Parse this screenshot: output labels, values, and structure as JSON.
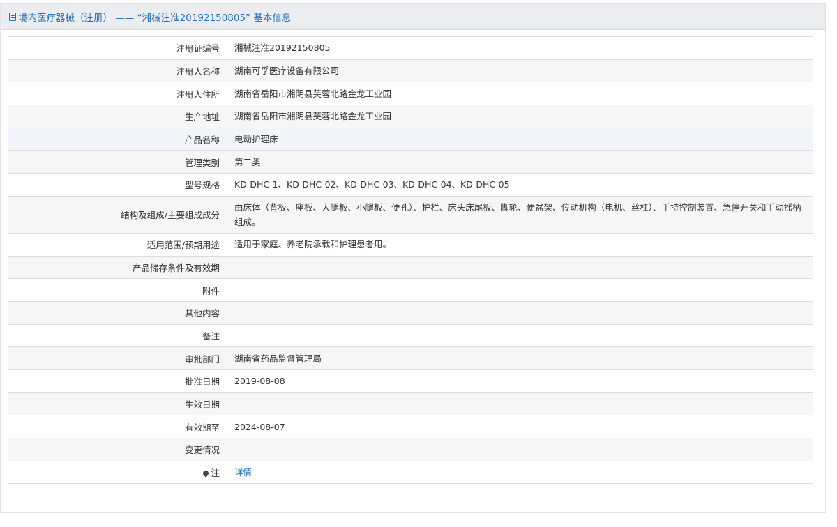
{
  "header": {
    "title": "境内医疗器械（注册） —— “湘械注准20192150805” 基本信息",
    "icon": "document-icon"
  },
  "rows": [
    {
      "label": "注册证编号",
      "value": "湘械注准20192150805"
    },
    {
      "label": "注册人名称",
      "value": "湖南可孚医疗设备有限公司"
    },
    {
      "label": "注册人住所",
      "value": "湖南省岳阳市湘阴县芙蓉北路金龙工业园"
    },
    {
      "label": "生产地址",
      "value": "湖南省岳阳市湘阴县芙蓉北路金龙工业园"
    },
    {
      "label": "产品名称",
      "value": "电动护理床"
    },
    {
      "label": "管理类别",
      "value": "第二类"
    },
    {
      "label": "型号规格",
      "value": "KD-DHC-1、KD-DHC-02、KD-DHC-03、KD-DHC-04、KD-DHC-05"
    },
    {
      "label": "结构及组成/主要组成成分",
      "value": "由床体（背板、座板、大腿板、小腿板、便孔）、护栏、床头床尾板、脚轮、便盆架、传动机构（电机、丝杠）、手持控制装置、急停开关和手动摇柄组成。"
    },
    {
      "label": "适用范围/预期用途",
      "value": "适用于家庭、养老院承载和护理患者用。"
    },
    {
      "label": "产品储存条件及有效期",
      "value": ""
    },
    {
      "label": "附件",
      "value": ""
    },
    {
      "label": "其他内容",
      "value": ""
    },
    {
      "label": "备注",
      "value": ""
    },
    {
      "label": "审批部门",
      "value": "湖南省药品监督管理局"
    },
    {
      "label": "批准日期",
      "value": "2019-08-08"
    },
    {
      "label": "生效日期",
      "value": ""
    },
    {
      "label": "有效期至",
      "value": "2024-08-07"
    },
    {
      "label": "变更情况",
      "value": ""
    }
  ],
  "note_row": {
    "label": "注",
    "icon": "pin-icon",
    "link_text": "详情"
  }
}
